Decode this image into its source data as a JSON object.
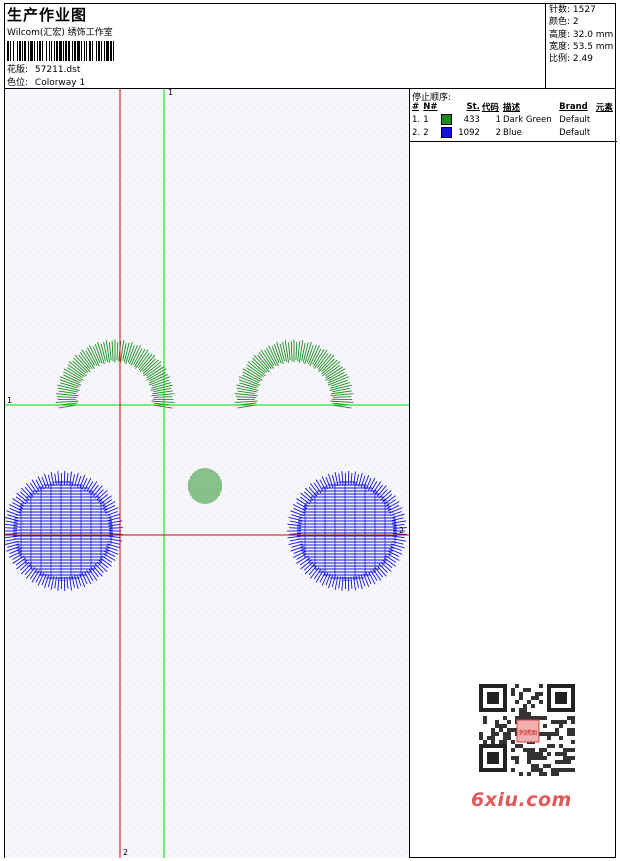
{
  "header": {
    "title": "生产作业图",
    "subtitle": "Wilcom(汇宏) 绣饰工作室",
    "design_label": "花版:",
    "design_value": "57211.dst",
    "colorway_label": "色位:",
    "colorway_value": "Colorway 1"
  },
  "stats": {
    "stitches": "针数: 1527",
    "colors": "颜色: 2",
    "height": "高度: 32.0 mm",
    "width": "宽度: 53.5 mm",
    "scale": "比例: 2.49"
  },
  "stop_sequence": {
    "title": "停止顺序:",
    "headers": [
      "#",
      "N#",
      "St.",
      "代码",
      "描述",
      "Brand",
      "元素"
    ],
    "rows": [
      {
        "idx": "1.",
        "n": "1",
        "color": "#1a8c1a",
        "st": "433",
        "code": "1",
        "desc": "Dark Green",
        "brand": "Default"
      },
      {
        "idx": "2.",
        "n": "2",
        "color": "#1010e0",
        "st": "1092",
        "code": "2",
        "desc": "Blue",
        "brand": "Default"
      }
    ]
  },
  "axes": {
    "v_green_label": "1",
    "h_green_label": "1",
    "v_red_label": "2",
    "h_red_label": "2"
  },
  "watermark": {
    "text": "6xiu.com",
    "seal_text": "刺绣图"
  },
  "colors": {
    "green": "#1a8c1a",
    "blue": "#1010e0",
    "guide_green": "#00dd00",
    "guide_red": "#e00000",
    "canvas": "#f6f6fb"
  }
}
